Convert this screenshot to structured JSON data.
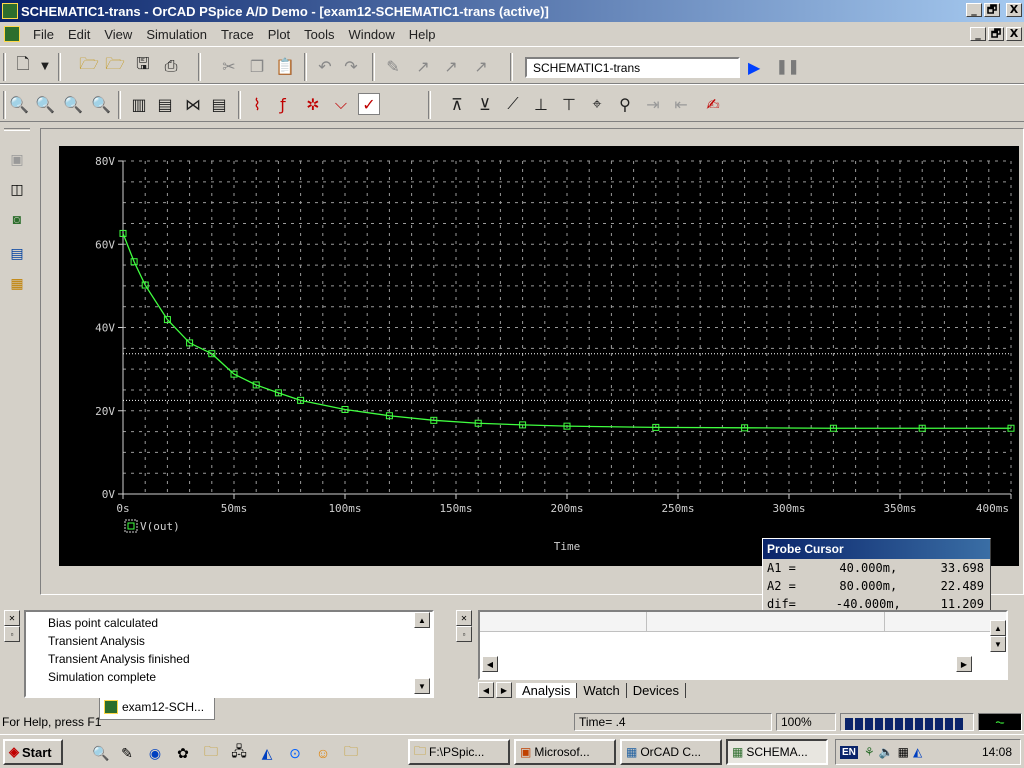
{
  "window": {
    "title": "SCHEMATIC1-trans - OrCAD PSpice A/D Demo - [exam12-SCHEMATIC1-trans (active)]",
    "controls": [
      "_",
      "🗗",
      "X"
    ]
  },
  "menu": {
    "items": [
      "File",
      "Edit",
      "View",
      "Simulation",
      "Trace",
      "Plot",
      "Tools",
      "Window",
      "Help"
    ]
  },
  "toolbar": {
    "profile": "SCHEMATIC1-trans",
    "run_icon": "▶",
    "pause_icon": "❚❚"
  },
  "plot": {
    "y_ticks": [
      "80V",
      "60V",
      "40V",
      "20V",
      "0V"
    ],
    "x_ticks": [
      "0s",
      "50ms",
      "100ms",
      "150ms",
      "200ms",
      "250ms",
      "300ms",
      "350ms",
      "400ms"
    ],
    "x_label": "Time",
    "trace_label": "V(out)",
    "trace_color": "#40ff40",
    "cursor_a1": 33.698,
    "cursor_a2": 22.489
  },
  "chart_data": {
    "type": "line",
    "xlabel": "Time",
    "ylabel": "",
    "xlim": [
      0,
      400
    ],
    "ylim": [
      0,
      80
    ],
    "x_unit": "ms",
    "series": [
      {
        "name": "V(out)",
        "x": [
          0,
          5,
          10,
          20,
          30,
          40,
          50,
          60,
          70,
          80,
          100,
          120,
          140,
          160,
          180,
          200,
          240,
          280,
          320,
          360,
          400
        ],
        "values": [
          62.6,
          55.8,
          50.2,
          41.9,
          36.3,
          33.7,
          28.8,
          26.2,
          24.3,
          22.5,
          20.3,
          18.8,
          17.7,
          17.0,
          16.6,
          16.3,
          16.0,
          15.9,
          15.8,
          15.8,
          15.8
        ]
      }
    ]
  },
  "doc_tab": "exam12-SCH...",
  "probe": {
    "title": "Probe Cursor",
    "rows": [
      {
        "label": "A1 =",
        "x": "40.000m,",
        "y": "33.698"
      },
      {
        "label": "A2 =",
        "x": "80.000m,",
        "y": "22.489"
      },
      {
        "label": "dif=",
        "x": "-40.000m,",
        "y": "11.209"
      }
    ]
  },
  "log": [
    "Bias point calculated",
    "Transient Analysis",
    "Transient Analysis finished",
    "Simulation complete"
  ],
  "watch_tabs": [
    "Analysis",
    "Watch",
    "Devices"
  ],
  "status": {
    "help": "For Help, press F1",
    "time": "Time= .4",
    "zoom": "100%",
    "progress": 1.0
  },
  "taskbar": {
    "start": "Start",
    "tasks": [
      "F:\\PSpic...",
      "Microsof...",
      "OrCAD C...",
      "SCHEMA..."
    ],
    "lang": "EN",
    "clock": "14:08"
  }
}
